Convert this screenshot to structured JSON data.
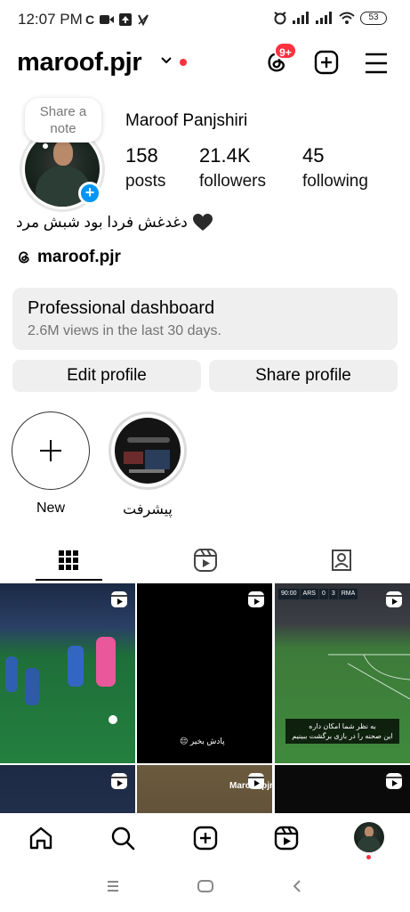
{
  "status_bar": {
    "time": "12:07 PM",
    "left_icons": [
      "c-icon",
      "video-icon",
      "upload-icon",
      "vpn-icon"
    ],
    "right_icons": [
      "alarm-icon",
      "signal-icon",
      "signal-icon",
      "wifi-icon"
    ],
    "battery": "53"
  },
  "header": {
    "username": "maroof.pjr",
    "notification_badge": "9+"
  },
  "profile": {
    "note": [
      "Share a",
      "note"
    ],
    "full_name": "Maroof Panjshiri",
    "stats": [
      {
        "value": "158",
        "label": "posts"
      },
      {
        "value": "21.4K",
        "label": "followers"
      },
      {
        "value": "45",
        "label": "following"
      }
    ],
    "bio": "دغدغش فردا بود شبش مرد",
    "threads_handle": "maroof.pjr"
  },
  "dashboard": {
    "title": "Professional dashboard",
    "subtitle": "2.6M views in the last 30 days."
  },
  "buttons": {
    "edit": "Edit profile",
    "share": "Share profile"
  },
  "highlights": [
    {
      "label": "New"
    },
    {
      "label": "پیشرفت"
    }
  ],
  "grid": {
    "caption_2": "پادش بخیر 😔",
    "caption_3": [
      "به نظر شما امکان داره",
      "این صحنه را در بازی برگشت ببینیم"
    ],
    "score": {
      "home": "ARS",
      "home_score": "0",
      "away_score": "3",
      "away": "RMA",
      "time": "90:00"
    },
    "watermark": "Maroof.pjr"
  },
  "colors": {
    "accent": "#0095f6",
    "badge": "#ff3040",
    "button_bg": "#efefef",
    "muted_text": "#737373"
  }
}
